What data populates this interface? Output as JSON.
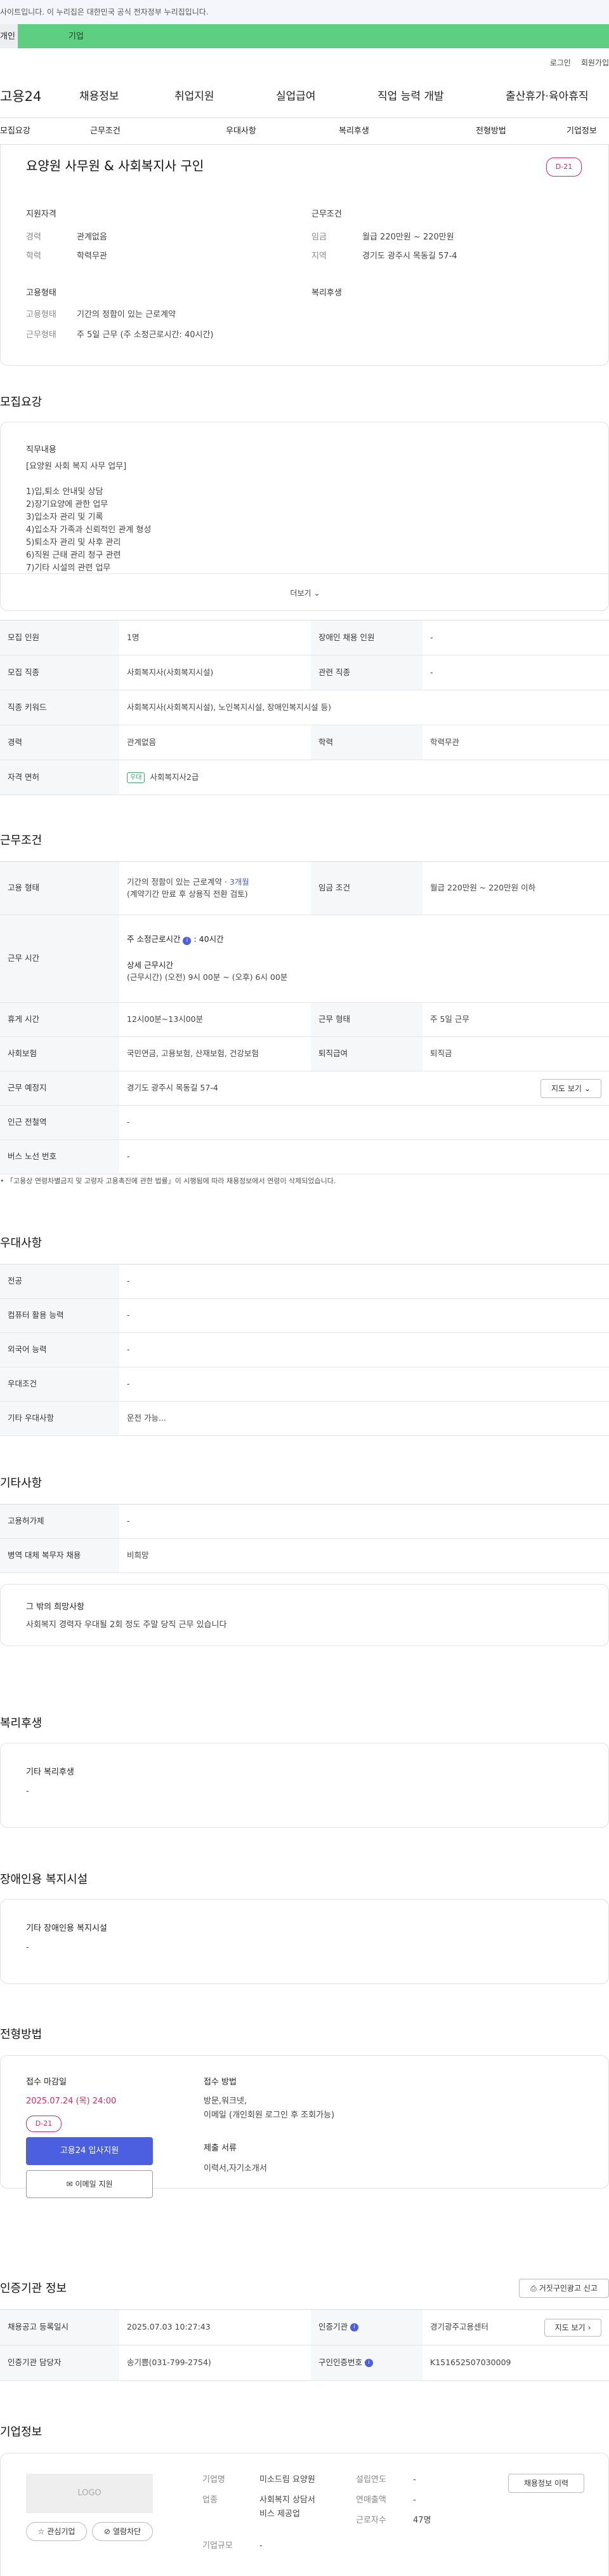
{
  "gov_banner": "사이트입니다. 이 누리집은 대한민국 공식 전자정부 누리집입니다.",
  "tabs": [
    "개인",
    "기업"
  ],
  "util": [
    "로그인",
    "회원가입"
  ],
  "logo": "고용24",
  "gnb": [
    "채용정보",
    "취업지원",
    "실업급여",
    "직업 능력 개발",
    "출산휴가·육아휴직"
  ],
  "lnb": [
    "모집요강",
    "근무조건",
    "우대사항",
    "복리후생",
    "전형방법",
    "기업정보"
  ],
  "job": {
    "title": "요양원 사무원 & 사회복지사 구인",
    "dday": "D-21"
  },
  "summary": {
    "qual_title": "지원자격",
    "exp_label": "경력",
    "exp": "관계없음",
    "edu_label": "학력",
    "edu": "학력무관",
    "cond_title": "근무조건",
    "wage_label": "임금",
    "wage": "월급 220만원 ~ 220만원",
    "area_label": "지역",
    "area": "경기도 광주시 목동길 57-4",
    "type_title": "고용형태",
    "type_label": "고용형태",
    "type": "기간의 정함이 있는 근로계약",
    "wtype_label": "근무형태",
    "wtype": "주 5일 근무 (주 소정근로시간: 40시간)",
    "welfare_title": "복리후생"
  },
  "recruit": {
    "title": "모집요강",
    "duty_title": "직무내용",
    "duty_lines": [
      "[요양원 사회 복지 사무 업무]",
      "",
      "1)입,퇴소 안내및 상담",
      "2)장기요양에 관한 업무",
      "3)입소자 관리 및 기록",
      "4)입소자 가족과 신뢰적인 관계 형성",
      "5)퇴소자 관리 및 사후 관리",
      "6)직원 근태 관리 청구 관련",
      "7)기타 시설의 관련 업무"
    ],
    "more": "더보기",
    "count_label": "모집 인원",
    "count": "1명",
    "disabled_label": "장애인 채용 인원",
    "disabled": "-",
    "job_label": "모집 직종",
    "job": "사회복지사(사회복지시설)",
    "related_label": "관련 직종",
    "related": "-",
    "kw_label": "직종 키워드",
    "kw": "사회복지사(사회복지시설), 노인복지시설, 장애인복지시설 등)",
    "exp_label": "경력",
    "exp": "관계없음",
    "edu_label": "학력",
    "edu": "학력무관",
    "license_label": "자격 면허",
    "license_tag": "우대",
    "license": "사회복지사2급"
  },
  "work": {
    "title": "근무조건",
    "type_label": "고용 형태",
    "type1": "기간의 정함이 있는 근로계약 · ",
    "type_month": "3개월",
    "type2": "(계약기간 만료 후 상용직 전환 검토)",
    "wage_label": "임금 조건",
    "wage": "월급 220만원 ~ 220만원 이하",
    "hours_label": "근무 시간",
    "hours_week_label": "주 소정근로시간",
    "hours_week": ": 40시간",
    "hours_detail_label": "상세 근무시간",
    "hours_detail": "(근무시간) (오전) 9시 00분 ~ (오후) 6시 00분",
    "rest_label": "휴게 시간",
    "rest": "12시00분~13시00분",
    "form_label": "근무 형태",
    "form": "주 5일 근무",
    "ins_label": "사회보험",
    "ins": "국민연금, 고용보험, 산재보험, 건강보험",
    "sev_label": "퇴직급여",
    "sev": "퇴직금",
    "place_label": "근무 예정지",
    "place": "경기도 광주시 목동길 57-4",
    "map_btn": "지도 보기",
    "subway_label": "인근 전철역",
    "subway": "-",
    "bus_label": "버스 노선 번호",
    "bus": "-",
    "note": "「고용상 연령차별금지 및 고령자 고용촉진에 관한 법률」이 시행됨에 따라 채용정보에서 연령이 삭제되었습니다."
  },
  "pref": {
    "title": "우대사항",
    "rows": [
      {
        "k": "전공",
        "v": "-"
      },
      {
        "k": "컴퓨터 활용 능력",
        "v": "-"
      },
      {
        "k": "외국어 능력",
        "v": "-"
      },
      {
        "k": "우대조건",
        "v": "-"
      },
      {
        "k": "기타 우대사항",
        "v": "운전 가능..."
      }
    ]
  },
  "etc": {
    "title": "기타사항",
    "rows": [
      {
        "k": "고용허가제",
        "v": "-"
      },
      {
        "k": "병역 대체 복무자 채용",
        "v": "비희망"
      }
    ],
    "hope_title": "그 밖의 희망사항",
    "hope": "사회복지 경력자 우대될 2회 정도 주말 당직 근무 있습니다"
  },
  "welfare": {
    "title": "복리후생",
    "sub": "기타 복리후생",
    "val": "-"
  },
  "disab": {
    "title": "장애인용 복지시설",
    "sub": "기타 장애인용 복지시설",
    "val": "-"
  },
  "proc": {
    "title": "전형방법",
    "deadline_label": "접수 마감일",
    "deadline": "2025.07.24 (목) 24:00",
    "dday": "D-21",
    "apply_btn": "고용24 입사지원",
    "email_btn": "이메일 지원",
    "method_label": "접수 방법",
    "method1": "방문,워크넷,",
    "method2": "이메일 (개인회원 로그인 후 조회가능)",
    "docs_label": "제출 서류",
    "docs": "이력서,자기소개서"
  },
  "agency": {
    "title": "인증기관 정보",
    "report_btn": "거짓구인광고 신고",
    "reg_label": "채용공고 등록일시",
    "reg": "2025.07.03 10:27:43",
    "org_label": "인증기관",
    "org": "경기광주고용센터",
    "map_btn": "지도 보기",
    "mgr_label": "인증기관 담당자",
    "mgr": "송기쁨(031-799-2754)",
    "no_label": "구인인증번호",
    "no": "K151652507030009"
  },
  "company": {
    "title": "기업정보",
    "logo": "LOGO",
    "interest_btn": "관심기업",
    "block_btn": "열람차단",
    "name_label": "기업명",
    "name": "미소드림 요양원",
    "industry_label": "업종",
    "industry1": "사회복지 상담서",
    "industry2": "비스 제공업",
    "scale_label": "기업규모",
    "scale": "-",
    "found_label": "설립연도",
    "found": "-",
    "sales_label": "연매출액",
    "sales": "-",
    "emp_label": "근로자수",
    "emp": "47명",
    "more_btn": "채용정보 이력"
  },
  "colors": {
    "green": "#5ecf82",
    "blue": "#4b5fe0",
    "red": "#e0245e"
  }
}
